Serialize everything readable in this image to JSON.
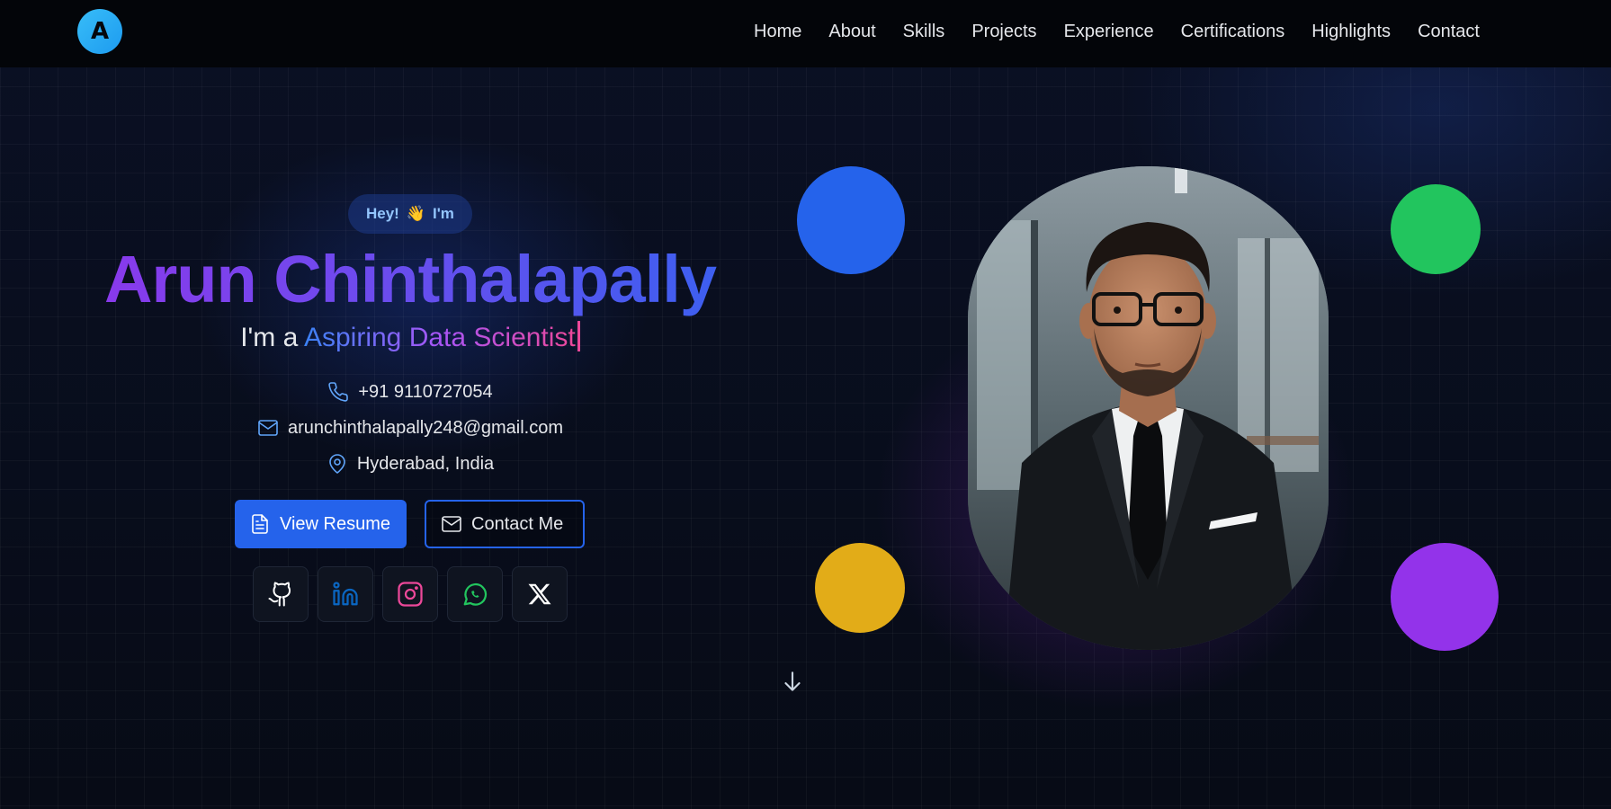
{
  "nav": {
    "logo_letter": "A",
    "links": [
      "Home",
      "About",
      "Skills",
      "Projects",
      "Experience",
      "Certifications",
      "Highlights",
      "Contact"
    ]
  },
  "hero": {
    "greeting_prefix": "Hey!",
    "greeting_emoji": "👋",
    "greeting_suffix": "I'm",
    "name": "Arun Chinthalapally",
    "tagline_prefix": "I'm a",
    "role": "Aspiring Data Scientist",
    "phone": "+91 9110727054",
    "email": "arunchinthalapally248@gmail.com",
    "location": "Hyderabad, India",
    "resume_button": "View Resume",
    "contact_button": "Contact Me"
  },
  "socials": [
    "github",
    "linkedin",
    "instagram",
    "whatsapp",
    "x"
  ],
  "colors": {
    "accent_blue": "#2563eb",
    "accent_purple": "#9333ea",
    "accent_green": "#22c55e",
    "accent_yellow": "#e2ac18",
    "background": "#070b16"
  }
}
